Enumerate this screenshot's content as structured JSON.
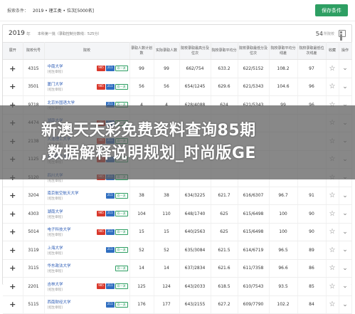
{
  "topbar": {
    "label": "报索条件：",
    "conditions": "2019 • 理工类 • 位次[5000名]",
    "save_label": "保存条件"
  },
  "yearbar": {
    "year": "2019",
    "year_unit": "年",
    "meta": "本科第一批（录取控制分数线：525分）",
    "count": "54",
    "count_unit": "所院校"
  },
  "columns": [
    "展开",
    "院校代号",
    "院校",
    "录取人数计划数",
    "实际录取人数",
    "院校录取最高分及位次",
    "院校录取平均分",
    "院校录取最低分及位次",
    "院校录取平均分线差",
    "院校录取最低位次线差",
    "收藏",
    "操作"
  ],
  "rows": [
    {
      "code": "4315",
      "name": "中南大学",
      "hint": "[招生章程]",
      "tags": [
        "985",
        "211",
        "双一流"
      ],
      "plan": "99",
      "admit": "99",
      "high": "662/754",
      "avg": "633.2",
      "low": "622/5152",
      "avgdiff": "108.2",
      "lowdiff": "97"
    },
    {
      "code": "3501",
      "name": "厦门大学",
      "hint": "[招生章程]",
      "tags": [
        "985",
        "211",
        "双一流"
      ],
      "plan": "56",
      "admit": "56",
      "high": "654/1245",
      "avg": "629.6",
      "low": "621/5343",
      "avgdiff": "104.6",
      "lowdiff": "96"
    },
    {
      "code": "9718",
      "name": "北京外国语大学",
      "hint": "[招生章程]",
      "tags": [
        "211",
        "双一流"
      ],
      "plan": "4",
      "admit": "4",
      "high": "628/4088",
      "avg": "624",
      "low": "621/5343",
      "avgdiff": "99",
      "lowdiff": "96"
    },
    {
      "code": "4474",
      "name": "湖南大学",
      "hint": "[招生章程]",
      "tags": [
        "985",
        "211",
        "双一流"
      ],
      "plan": "",
      "admit": "",
      "high": "",
      "avg": "",
      "low": "",
      "avgdiff": "",
      "lowdiff": ""
    },
    {
      "code": "2138",
      "name": "大连理工大学",
      "hint": "[招生章程]",
      "tags": [
        "985",
        "211",
        "双一流"
      ],
      "plan": "",
      "admit": "",
      "high": "",
      "avg": "",
      "low": "",
      "avgdiff": "",
      "lowdiff": ""
    },
    {
      "code": "1125",
      "name": "北京理工大学",
      "hint": "[招生章程]",
      "tags": [
        "985",
        "211",
        "双一流"
      ],
      "plan": "",
      "admit": "",
      "high": "",
      "avg": "",
      "low": "",
      "avgdiff": "",
      "lowdiff": ""
    },
    {
      "code": "5120",
      "name": "四川大学",
      "hint": "[招生章程]",
      "tags": [
        "985",
        "211",
        "双一流"
      ],
      "plan": "",
      "admit": "",
      "high": "",
      "avg": "",
      "low": "",
      "avgdiff": "",
      "lowdiff": ""
    },
    {
      "code": "3204",
      "name": "南京航空航天大学",
      "hint": "[招生章程]",
      "tags": [
        "211",
        "双一流"
      ],
      "plan": "38",
      "admit": "38",
      "high": "634/3225",
      "avg": "621.7",
      "low": "616/6307",
      "avgdiff": "96.7",
      "lowdiff": "91"
    },
    {
      "code": "4303",
      "name": "湖南大学",
      "hint": "[招生章程]",
      "tags": [
        "985",
        "211",
        "双一流"
      ],
      "plan": "104",
      "admit": "110",
      "high": "648/1740",
      "avg": "625",
      "low": "615/6498",
      "avgdiff": "100",
      "lowdiff": "90"
    },
    {
      "code": "5014",
      "name": "电子科技大学",
      "hint": "[招生章程]",
      "tags": [
        "985",
        "211",
        "双一流"
      ],
      "plan": "15",
      "admit": "15",
      "high": "640/2563",
      "avg": "625",
      "low": "615/6498",
      "avgdiff": "100",
      "lowdiff": "90"
    },
    {
      "code": "3119",
      "name": "上海大学",
      "hint": "[招生章程]",
      "tags": [
        "211",
        "双一流"
      ],
      "plan": "52",
      "admit": "52",
      "high": "635/3084",
      "avg": "621.5",
      "low": "614/6719",
      "avgdiff": "96.5",
      "lowdiff": "89"
    },
    {
      "code": "3115",
      "name": "华东政法大学",
      "hint": "[招生章程]",
      "tags": [
        "双一流"
      ],
      "plan": "14",
      "admit": "14",
      "high": "637/2834",
      "avg": "621.6",
      "low": "611/7358",
      "avgdiff": "96.6",
      "lowdiff": "86"
    },
    {
      "code": "2201",
      "name": "吉林大学",
      "hint": "[招生章程]",
      "tags": [
        "985",
        "211",
        "双一流"
      ],
      "plan": "125",
      "admit": "124",
      "high": "643/2033",
      "avg": "618.5",
      "low": "610/7543",
      "avgdiff": "93.5",
      "lowdiff": "85"
    },
    {
      "code": "5115",
      "name": "西南财经大学",
      "hint": "[招生章程]",
      "tags": [
        "211",
        "双一流"
      ],
      "plan": "176",
      "admit": "177",
      "high": "643/2155",
      "avg": "627.2",
      "low": "609/7790",
      "avgdiff": "102.2",
      "lowdiff": "84"
    }
  ],
  "banner": {
    "line1": "新澳天天彩免费资料查询85期",
    "line2": ",数据解释说明规划_时尚版GE"
  },
  "colors": {
    "accent": "#2e9f63",
    "tag985": "#d9382c",
    "tag211": "#2f6ec0",
    "link": "#2b5bb5"
  },
  "icons": {
    "expand": "plus-icon",
    "favorite": "star-icon",
    "action": "chevron-down-icon",
    "view": "grid-icon"
  }
}
